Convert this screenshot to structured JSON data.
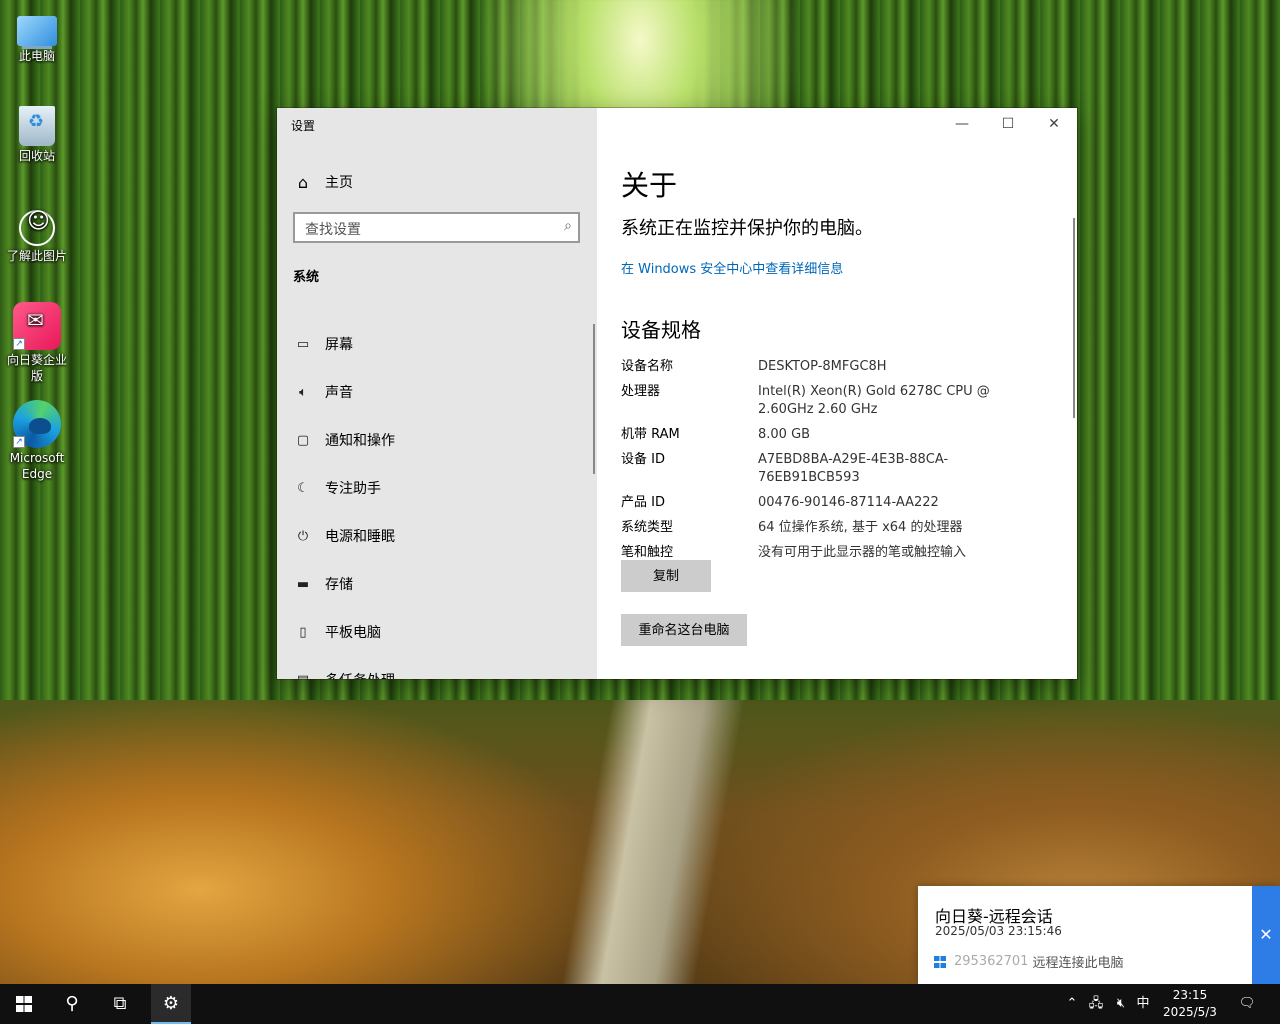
{
  "desktop": {
    "icons": [
      {
        "label": "此电脑"
      },
      {
        "label": "回收站"
      },
      {
        "label": "了解此图片"
      },
      {
        "label": "向日葵企业版"
      },
      {
        "label": "Microsoft Edge"
      }
    ]
  },
  "window": {
    "title": "设置",
    "controls": {
      "minimize": "—",
      "maximize": "☐",
      "close": "✕"
    }
  },
  "sidebar": {
    "home_label": "主页",
    "search_placeholder": "查找设置",
    "section_label": "系统",
    "items": [
      {
        "label": "屏幕",
        "icon": "monitor-icon"
      },
      {
        "label": "声音",
        "icon": "speaker-icon"
      },
      {
        "label": "通知和操作",
        "icon": "notification-icon"
      },
      {
        "label": "专注助手",
        "icon": "moon-icon"
      },
      {
        "label": "电源和睡眠",
        "icon": "power-icon"
      },
      {
        "label": "存储",
        "icon": "storage-icon"
      },
      {
        "label": "平板电脑",
        "icon": "tablet-icon"
      },
      {
        "label": "多任务处理",
        "icon": "multitask-icon"
      }
    ]
  },
  "about": {
    "title": "关于",
    "status": "系统正在监控并保护你的电脑。",
    "security_link": "在 Windows 安全中心中查看详细信息",
    "specs_title": "设备规格",
    "specs": [
      {
        "key": "设备名称",
        "value": "DESKTOP-8MFGC8H"
      },
      {
        "key": "处理器",
        "value": "Intel(R) Xeon(R) Gold 6278C CPU @ 2.60GHz   2.60 GHz"
      },
      {
        "key": "机带 RAM",
        "value": "8.00 GB"
      },
      {
        "key": "设备 ID",
        "value": "A7EBD8BA-A29E-4E3B-88CA-76EB91BCB593"
      },
      {
        "key": "产品 ID",
        "value": "00476-90146-87114-AA222"
      },
      {
        "key": "系统类型",
        "value": "64 位操作系统, 基于 x64 的处理器"
      },
      {
        "key": "笔和触控",
        "value": "没有可用于此显示器的笔或触控输入"
      }
    ],
    "copy_button": "复制",
    "rename_button": "重命名这台电脑"
  },
  "notification": {
    "title": "向日葵-远程会话",
    "time": "2025/05/03 23:15:46",
    "id": "295362701",
    "message": "远程连接此电脑",
    "close": "✕",
    "accent": "#2e7de6"
  },
  "taskbar": {
    "ime": "中",
    "time": "23:15",
    "date": "2025/5/3"
  }
}
